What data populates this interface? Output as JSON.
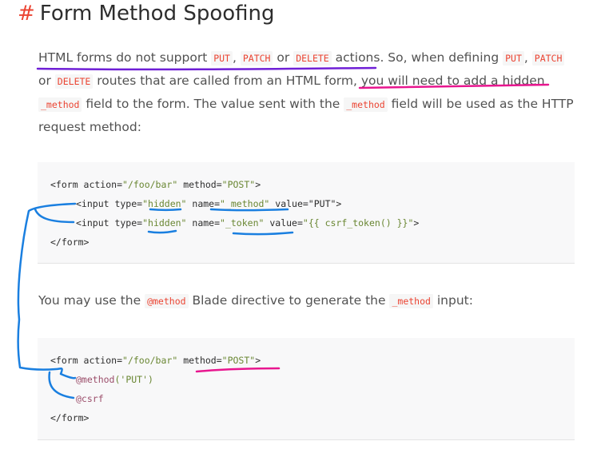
{
  "heading": {
    "hash": "#",
    "title": "Form Method Spoofing"
  },
  "para1": {
    "t1": "HTML forms do not support ",
    "c1": "PUT",
    "t2": ", ",
    "c2": "PATCH",
    "t3": " or ",
    "c3": "DELETE",
    "t4": " actions. So, when defining ",
    "c4": "PUT",
    "t5": ", ",
    "c5": "PATCH",
    "t6": "or ",
    "c6": "DELETE",
    "t7": " routes that are called from an HTML form, you will need to add a hidden",
    "c7": "_method",
    "t8": " field to the form. The value sent with the ",
    "c8": "_method",
    "t9": " field will be used as the HTTP",
    "t10": "request method:"
  },
  "code1": {
    "l1a": "<form action=",
    "l1b": "\"/foo/bar\"",
    "l1c": " method=",
    "l1d": "\"POST\"",
    "l1e": ">",
    "l2a": "<input type=",
    "l2b": "\"hidden\"",
    "l2c": " name=",
    "l2d": "\"_method\"",
    "l2e": " value=\"PUT\">",
    "l3a": "<input type=",
    "l3b": "\"hidden\"",
    "l3c": " name=",
    "l3d": "\"_token\"",
    "l3e": " value=",
    "l3f": "\"{{ csrf_token() }}\"",
    "l3g": ">",
    "l4": "</form>"
  },
  "para2": {
    "t1": "You may use the ",
    "c1": "@method",
    "t2": " Blade directive to generate the ",
    "c2": "_method",
    "t3": " input:"
  },
  "code2": {
    "l1a": "<form action=",
    "l1b": "\"/foo/bar\"",
    "l1c": " method=",
    "l1d": "\"POST\"",
    "l1e": ">",
    "l2a": "@method",
    "l2b": "('PUT')",
    "l3": "@csrf",
    "l4": "</form>"
  },
  "colors": {
    "accent": "#eb4432",
    "annotation_blue": "#1a7fe0",
    "annotation_purple": "#6f1fd6",
    "annotation_magenta": "#e8168f"
  }
}
